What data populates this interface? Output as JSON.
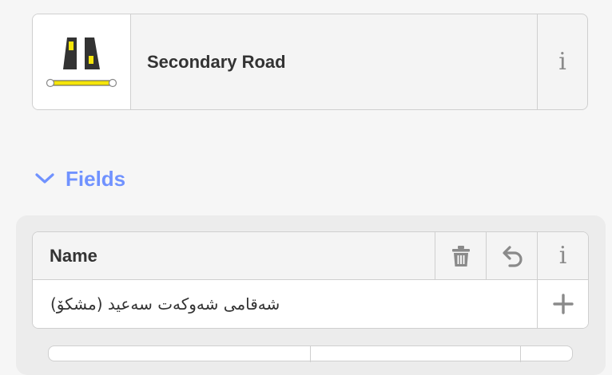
{
  "preset": {
    "name": "Secondary Road",
    "icon": "secondary-road-icon",
    "info_icon": "i"
  },
  "fields_section": {
    "label": "Fields",
    "expanded": true,
    "accent_color": "#7092ff"
  },
  "name_field": {
    "label": "Name",
    "value": "شەقامی شەوکەت سەعید (مشکۆ)",
    "info_icon": "i",
    "buttons": [
      "trash-icon",
      "undo-icon",
      "info-icon",
      "plus-icon"
    ]
  }
}
